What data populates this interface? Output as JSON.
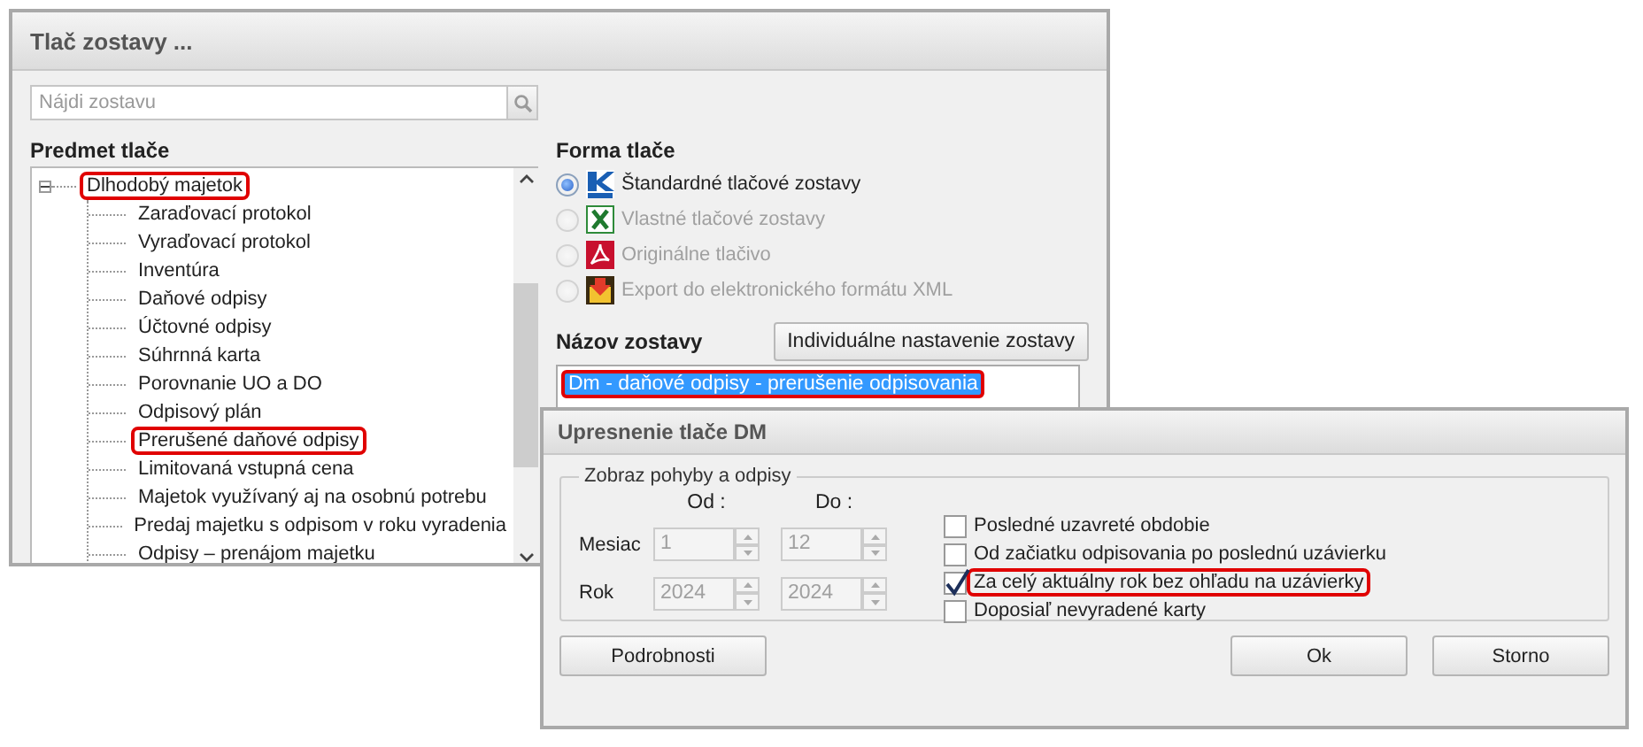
{
  "main_window": {
    "title": "Tlač zostavy ...",
    "search": {
      "placeholder": "Nájdi zostavu"
    },
    "subject": {
      "heading": "Predmet tlače",
      "tree": [
        {
          "label": "Dlhodobý majetok",
          "expanded": true,
          "highlighted": true,
          "children": [
            {
              "label": "Zaraďovací protokol",
              "highlighted": false
            },
            {
              "label": "Vyraďovací protokol",
              "highlighted": false
            },
            {
              "label": "Inventúra",
              "highlighted": false
            },
            {
              "label": "Daňové odpisy",
              "highlighted": false
            },
            {
              "label": "Účtovné odpisy",
              "highlighted": false
            },
            {
              "label": "Súhrnná karta",
              "highlighted": false
            },
            {
              "label": "Porovnanie UO a DO",
              "highlighted": false
            },
            {
              "label": "Odpisový plán",
              "highlighted": false
            },
            {
              "label": "Prerušené daňové odpisy",
              "highlighted": true
            },
            {
              "label": "Limitovaná vstupná cena",
              "highlighted": false
            },
            {
              "label": "Majetok využívaný aj na osobnú potrebu",
              "highlighted": false
            },
            {
              "label": "Predaj majetku s odpisom v roku vyradenia",
              "highlighted": false
            },
            {
              "label": "Odpisy – prenájom majetku",
              "highlighted": false
            }
          ]
        }
      ]
    },
    "print_form": {
      "heading": "Forma tlače",
      "options": [
        {
          "label": "Štandardné tlačové zostavy",
          "kind": "kros",
          "selected": true,
          "disabled": false
        },
        {
          "label": "Vlastné tlačové zostavy",
          "kind": "excel",
          "selected": false,
          "disabled": true
        },
        {
          "label": "Originálne tlačivo",
          "kind": "pdf",
          "selected": false,
          "disabled": true
        },
        {
          "label": "Export do elektronického formátu XML",
          "kind": "xml",
          "selected": false,
          "disabled": true
        }
      ]
    },
    "report_name": {
      "heading": "Názov zostavy",
      "button": "Individuálne nastavenie zostavy",
      "items": [
        {
          "label": "Dm - daňové odpisy - prerušenie odpisovania",
          "selected": true,
          "highlighted": true
        }
      ]
    }
  },
  "dialog": {
    "title": "Upresnenie tlače DM",
    "group": {
      "title": "Zobraz pohyby a odpisy",
      "from_label": "Od :",
      "to_label": "Do :",
      "disabled": true,
      "rows": [
        {
          "label": "Mesiac",
          "from": "1",
          "to": "12"
        },
        {
          "label": "Rok",
          "from": "2024",
          "to": "2024"
        }
      ],
      "options": [
        {
          "label": "Posledné uzavreté obdobie",
          "checked": false,
          "highlighted": false
        },
        {
          "label": "Od začiatku odpisovania po poslednú uzávierku",
          "checked": false,
          "highlighted": false
        },
        {
          "label": "Za celý aktuálny rok bez ohľadu na uzávierky",
          "checked": true,
          "highlighted": true
        },
        {
          "label": "Doposiaľ nevyradené karty",
          "checked": false,
          "highlighted": false
        }
      ]
    },
    "buttons": [
      {
        "label": "Podrobnosti",
        "kind": "left"
      },
      {
        "label": "Ok",
        "kind": "right"
      },
      {
        "label": "Storno",
        "kind": "right"
      }
    ]
  }
}
